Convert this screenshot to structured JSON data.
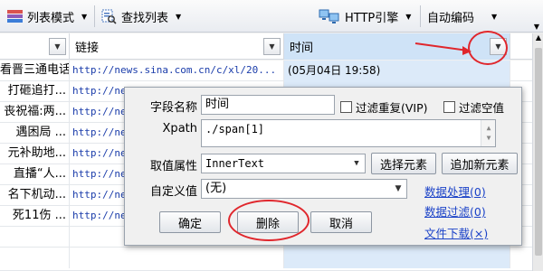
{
  "toolbar": {
    "list_mode_label": "列表模式",
    "find_list_label": "查找列表",
    "http_engine_label": "HTTP引擎",
    "auto_encoding_label": "自动编码"
  },
  "grid": {
    "headers": [
      "链接",
      "时间"
    ],
    "rows": [
      {
        "title": "看晋三通电话",
        "link": "http://news.sina.com.cn/c/xl/20...",
        "time": "(05月04日 19:58)"
      },
      {
        "title": "打砸追打...",
        "link": "http://ne",
        "time": ""
      },
      {
        "title": "丧祝福:两...",
        "link": "http://ne",
        "time": ""
      },
      {
        "title": "遇困局 ...",
        "link": "http://ne",
        "time": ""
      },
      {
        "title": "元补助地...",
        "link": "http://ne",
        "time": ""
      },
      {
        "title": "直播“人...",
        "link": "http://ne",
        "time": ""
      },
      {
        "title": "名下机动...",
        "link": "http://ne",
        "time": ""
      },
      {
        "title": "死11伤 ...",
        "link": "http://ne",
        "time": ""
      },
      {
        "title": "",
        "link": "",
        "time": ""
      }
    ]
  },
  "dialog": {
    "field_name_label": "字段名称",
    "field_name_value": "时间",
    "filter_dup_label": "过滤重复(VIP)",
    "filter_empty_label": "过滤空值",
    "xpath_label": "Xpath",
    "xpath_value": "./span[1]",
    "attr_label": "取值属性",
    "attr_value": "InnerText",
    "select_element_label": "选择元素",
    "add_element_label": "追加新元素",
    "custom_label": "自定义值",
    "custom_value": "(无)",
    "data_process_label": "数据处理(0)",
    "data_filter_label": "数据过滤(0)",
    "file_download_label": "文件下载(×)",
    "ok_label": "确定",
    "delete_label": "删除",
    "cancel_label": "取消"
  },
  "colors": {
    "accent_blue": "#1c43c8",
    "annotation_red": "#e0262c",
    "header_selected": "#cfe3f7"
  }
}
